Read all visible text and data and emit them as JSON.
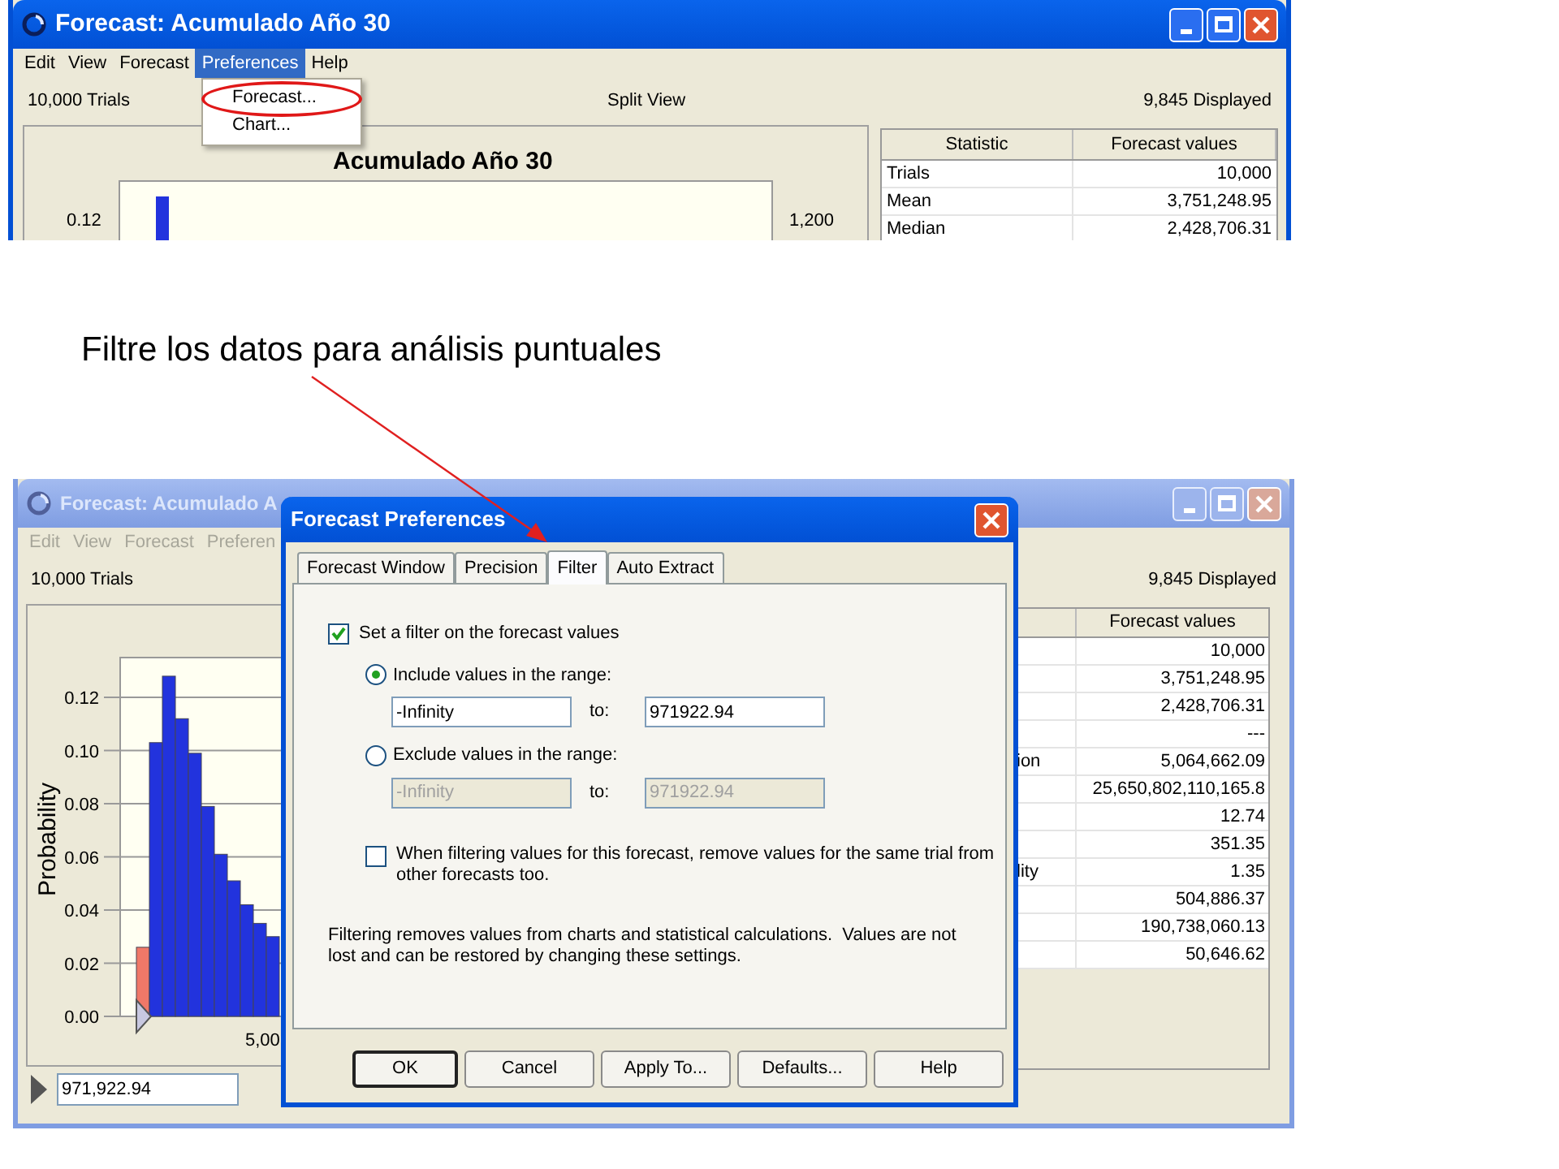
{
  "top_window": {
    "title": "Forecast: Acumulado Año 30",
    "active": true,
    "menu": [
      {
        "label": "Edit",
        "selected": false,
        "disabled": false
      },
      {
        "label": "View",
        "selected": false,
        "disabled": false
      },
      {
        "label": "Forecast",
        "selected": false,
        "disabled": false
      },
      {
        "label": "Preferences",
        "selected": true,
        "disabled": false
      },
      {
        "label": "Help",
        "selected": false,
        "disabled": false
      }
    ],
    "dropdown": [
      {
        "label": "Forecast...",
        "circled": true
      },
      {
        "label": "Chart...",
        "circled": false
      }
    ],
    "trials": "10,000 Trials",
    "view": "Split View",
    "displayed": "9,845 Displayed",
    "chart": {
      "title": "Acumulado Año 30",
      "y_tick": "0.12",
      "y2_tick": "1,200"
    },
    "stats_table": {
      "columns": [
        "Statistic",
        "Forecast values"
      ],
      "rows": [
        [
          "Trials",
          "10,000"
        ],
        [
          "Mean",
          "3,751,248.95"
        ],
        [
          "Median",
          "2,428,706.31"
        ]
      ]
    }
  },
  "annotation": {
    "text": "Filtre los datos para análisis puntuales"
  },
  "bottom_window": {
    "title": "Forecast: Acumulado A",
    "active": false,
    "menu": [
      {
        "label": "Edit",
        "selected": false,
        "disabled": true
      },
      {
        "label": "View",
        "selected": false,
        "disabled": true
      },
      {
        "label": "Forecast",
        "selected": false,
        "disabled": true
      },
      {
        "label": "Preferen",
        "selected": false,
        "disabled": true
      }
    ],
    "trials": "10,000 Trials",
    "displayed": "9,845 Displayed",
    "chart": {
      "x_tick": "5,00",
      "chart_data": {
        "type": "bar",
        "ylabel": "Probability",
        "stacked": true,
        "grid": true,
        "ylim": [
          0,
          0.135
        ],
        "yticks": [
          {
            "value": 0,
            "label": "0.00"
          },
          {
            "value": 0.02,
            "label": "0.02"
          },
          {
            "value": 0.04,
            "label": "0.04"
          },
          {
            "value": 0.06,
            "label": "0.06"
          },
          {
            "value": 0.08,
            "label": "0.08"
          },
          {
            "value": 0.1,
            "label": "0.10"
          },
          {
            "value": 0.12,
            "label": "0.12"
          }
        ],
        "series": [
          {
            "color": "#f07868",
            "values": [
              0.026,
              null,
              null,
              null,
              null,
              null,
              null,
              null,
              null,
              null,
              null
            ]
          },
          {
            "color": "#2233dd",
            "values": [
              null,
              0.103,
              0.128,
              0.112,
              0.099,
              0.079,
              0.061,
              0.051,
              0.042,
              0.035,
              0.03
            ]
          }
        ]
      }
    },
    "value_field": "971,922.94",
    "stats_table": {
      "header": "Forecast values",
      "rows": [
        {
          "value": "10,000"
        },
        {
          "value": "3,751,248.95"
        },
        {
          "value": "2,428,706.31"
        },
        {
          "value": "---"
        },
        {
          "label": "ion",
          "value": "5,064,662.09"
        },
        {
          "value": "25,650,802,110,165.8"
        },
        {
          "value": "12.74"
        },
        {
          "value": "351.35"
        },
        {
          "label": "lity",
          "value": "1.35"
        },
        {
          "value": "504,886.37"
        },
        {
          "value": "190,738,060.13"
        },
        {
          "value": "50,646.62"
        }
      ]
    }
  },
  "dialog": {
    "title": "Forecast Preferences",
    "tabs": [
      {
        "label": "Forecast Window",
        "selected": false
      },
      {
        "label": "Precision",
        "selected": false
      },
      {
        "label": "Filter",
        "selected": true
      },
      {
        "label": "Auto Extract",
        "selected": false
      }
    ],
    "filter_checkbox": {
      "label": "Set a filter on the forecast values",
      "checked": true
    },
    "range_options": [
      {
        "label": "Include values in the range:",
        "selected": true,
        "from": "-Infinity",
        "to_label": "to:",
        "to": "971922.94"
      },
      {
        "label": "Exclude values in the range:",
        "selected": false,
        "from": "-Infinity",
        "to_label": "to:",
        "to": "971922.94"
      }
    ],
    "same_trial_checkbox": {
      "label": "When filtering values for this forecast, remove values for the same trial from other forecasts too.",
      "checked": false
    },
    "note": "Filtering removes values from charts and statistical calculations.  Values are not lost and can be restored by changing these settings.",
    "buttons": [
      {
        "label": "OK",
        "default": true
      },
      {
        "label": "Cancel",
        "default": false
      },
      {
        "label": "Apply To...",
        "default": false
      },
      {
        "label": "Defaults...",
        "default": false
      },
      {
        "label": "Help",
        "default": false
      }
    ]
  }
}
